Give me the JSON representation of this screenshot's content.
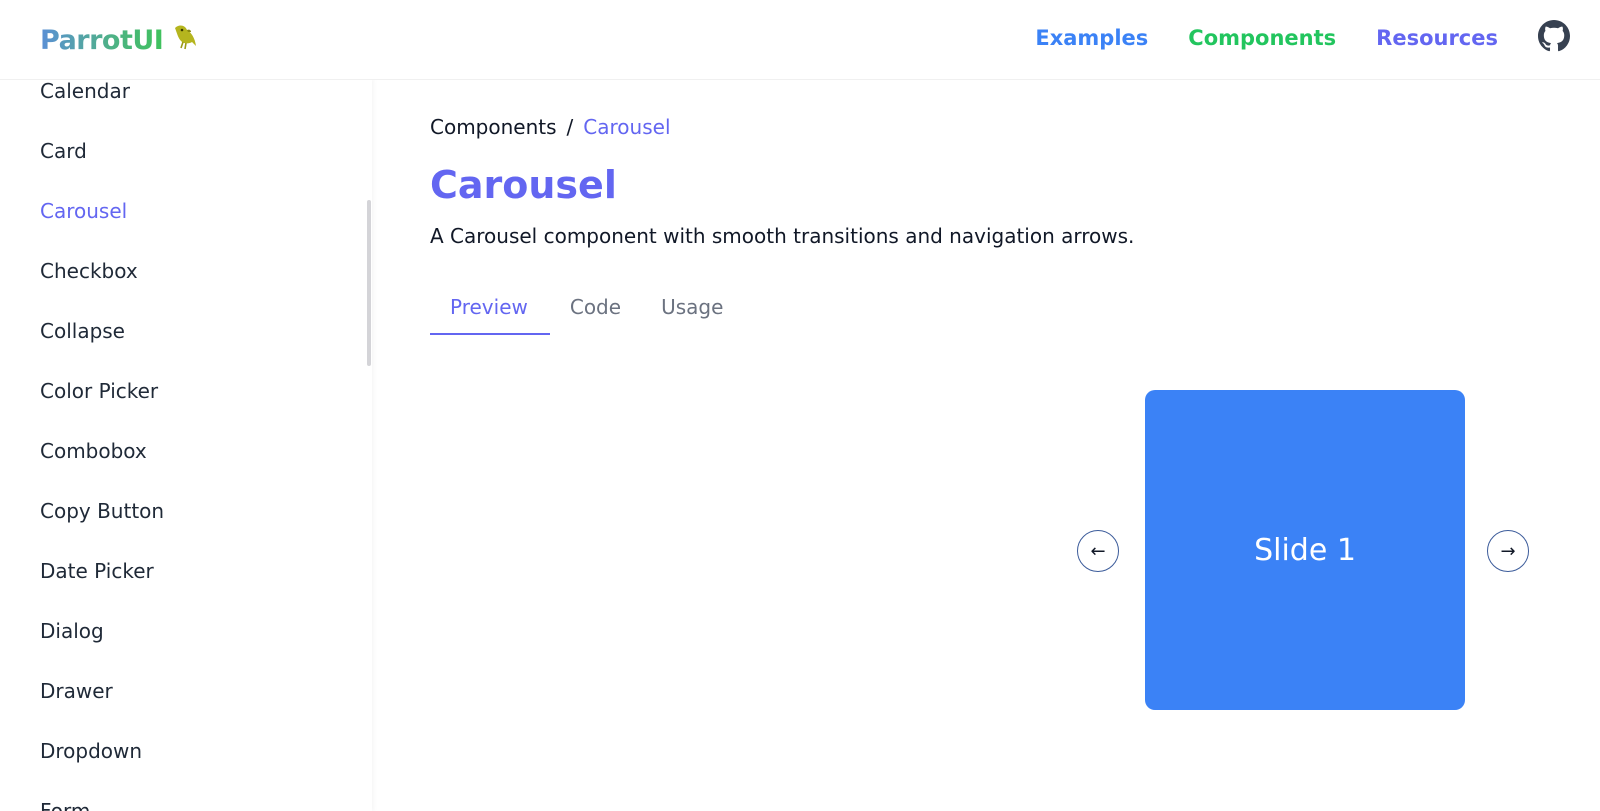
{
  "brand": {
    "name": "ParrotUI",
    "logo_icon": "parrot-icon"
  },
  "nav": {
    "examples": "Examples",
    "components": "Components",
    "resources": "Resources",
    "github_icon": "github-icon"
  },
  "colors": {
    "accent": "#6366f1",
    "slide": "#3b82f6",
    "examples": "#3b82f6",
    "components": "#22c55e"
  },
  "sidebar": {
    "items": [
      {
        "label": "Calendar"
      },
      {
        "label": "Card"
      },
      {
        "label": "Carousel",
        "active": true
      },
      {
        "label": "Checkbox"
      },
      {
        "label": "Collapse"
      },
      {
        "label": "Color Picker"
      },
      {
        "label": "Combobox"
      },
      {
        "label": "Copy Button"
      },
      {
        "label": "Date Picker"
      },
      {
        "label": "Dialog"
      },
      {
        "label": "Drawer"
      },
      {
        "label": "Dropdown"
      },
      {
        "label": "Form"
      }
    ]
  },
  "breadcrumb": {
    "root": "Components",
    "separator": "/",
    "current": "Carousel"
  },
  "page": {
    "title": "Carousel",
    "description": "A Carousel component with smooth transitions and navigation arrows."
  },
  "tabs": {
    "preview": "Preview",
    "code": "Code",
    "usage": "Usage",
    "active": "Preview"
  },
  "carousel": {
    "slide_label": "Slide 1",
    "prev_symbol": "←",
    "next_symbol": "→"
  }
}
